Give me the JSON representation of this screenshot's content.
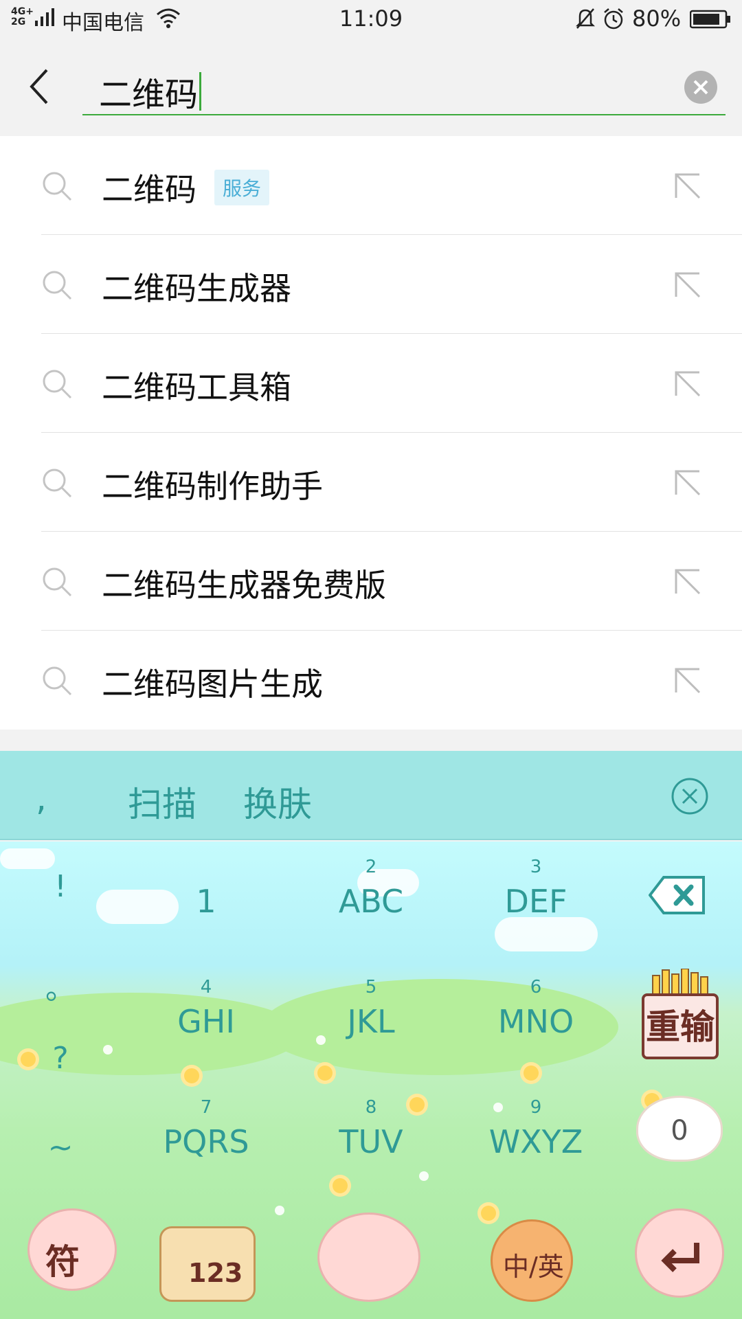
{
  "status_bar": {
    "network": "4G+ 2G",
    "carrier": "中国电信",
    "time": "11:09",
    "battery_percent": "80%",
    "icons": [
      "signal-icon",
      "wifi-icon",
      "bell-muted-icon",
      "alarm-icon",
      "battery-icon"
    ]
  },
  "search": {
    "query": "二维码",
    "back_icon": "back-arrow-icon",
    "clear_icon": "clear-icon"
  },
  "suggestions": [
    {
      "text": "二维码",
      "badge": "服务"
    },
    {
      "text": "二维码生成器",
      "badge": ""
    },
    {
      "text": "二维码工具箱",
      "badge": ""
    },
    {
      "text": "二维码制作助手",
      "badge": ""
    },
    {
      "text": "二维码生成器免费版",
      "badge": ""
    },
    {
      "text": "二维码图片生成",
      "badge": ""
    }
  ],
  "candidate_bar": {
    "comma": ",",
    "items": [
      "扫描",
      "换肤"
    ],
    "close_icon": "close-circle-icon"
  },
  "keyboard": {
    "punctuation": [
      "!",
      "。",
      "?",
      "~"
    ],
    "keys": [
      {
        "num": "",
        "letters": "1"
      },
      {
        "num": "2",
        "letters": "ABC"
      },
      {
        "num": "3",
        "letters": "DEF"
      },
      {
        "num": "4",
        "letters": "GHI"
      },
      {
        "num": "5",
        "letters": "JKL"
      },
      {
        "num": "6",
        "letters": "MNO"
      },
      {
        "num": "7",
        "letters": "PQRS"
      },
      {
        "num": "8",
        "letters": "TUV"
      },
      {
        "num": "9",
        "letters": "WXYZ"
      }
    ],
    "retype_label": "重输",
    "zero_label": "0",
    "symbol_label": "符",
    "num123_label": "123",
    "lang_label": "中/英",
    "colors": {
      "key_text": "#2f9a96",
      "candidate_bg": "#9fe6e4",
      "accent_green": "#3caa3c"
    }
  }
}
